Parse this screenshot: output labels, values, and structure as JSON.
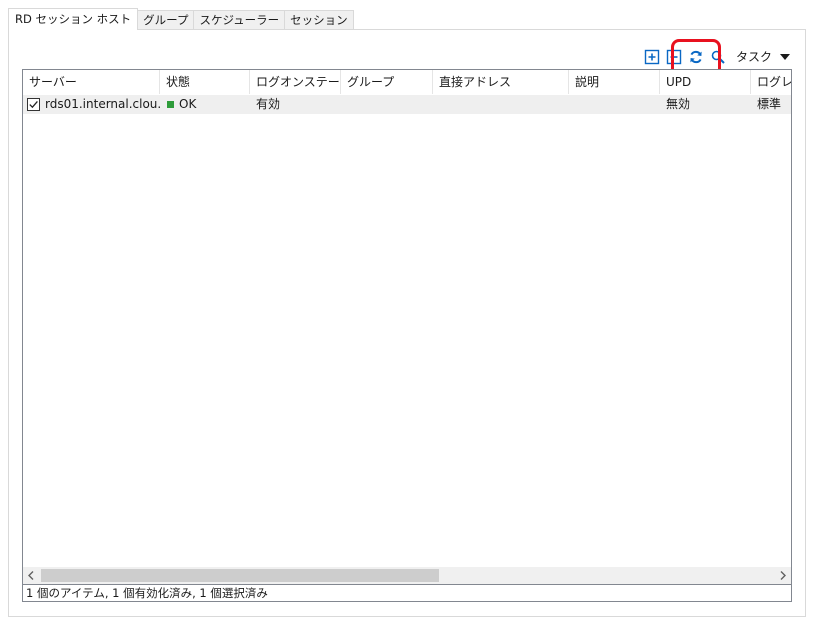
{
  "tabs": [
    {
      "label": "RD セッション ホスト",
      "active": true
    },
    {
      "label": "グループ",
      "active": false
    },
    {
      "label": "スケジューラー",
      "active": false
    },
    {
      "label": "セッション",
      "active": false
    }
  ],
  "toolbar": {
    "tasks_label": "タスク",
    "icons": [
      "expand-icon",
      "collapse-icon",
      "refresh-icon",
      "search-icon"
    ],
    "accent_color": "#0a68c4",
    "highlight_color": "#e8111f"
  },
  "table": {
    "columns": [
      "サーバー",
      "状態",
      "ログオンステー...",
      "グループ",
      "直接アドレス",
      "説明",
      "UPD",
      "ログレ^"
    ],
    "rows": [
      {
        "checked": true,
        "server": "rds01.internal.clou...",
        "status": "OK",
        "status_color": "#2e9c3a",
        "logon_state": "有効",
        "group": "",
        "direct_address": "",
        "description": "",
        "upd": "無効",
        "log_level": "標準"
      }
    ]
  },
  "status_bar": {
    "text": "1 個のアイテム, 1 個有効化済み, 1 個選択済み"
  }
}
